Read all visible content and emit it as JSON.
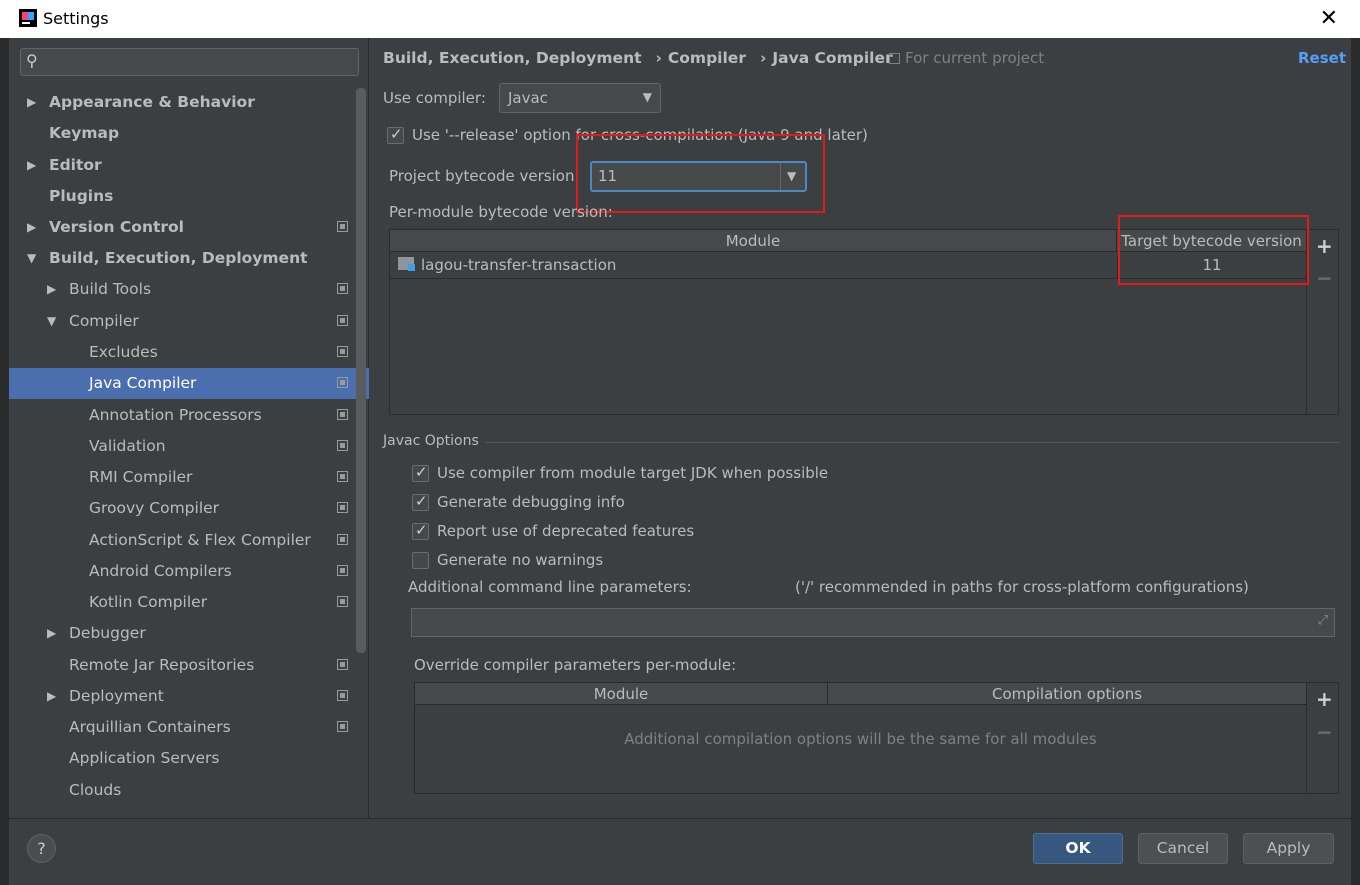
{
  "window": {
    "title": "Settings",
    "close_glyph": "✕"
  },
  "search": {
    "placeholder": "",
    "icon": "search-icon"
  },
  "sidebar": {
    "items": [
      {
        "label": "Appearance & Behavior",
        "arrow": "▶"
      },
      {
        "label": "Keymap"
      },
      {
        "label": "Editor",
        "arrow": "▶"
      },
      {
        "label": "Plugins"
      },
      {
        "label": "Version Control",
        "arrow": "▶"
      },
      {
        "label": "Build, Execution, Deployment",
        "arrow": "▼"
      },
      {
        "label": "Build Tools",
        "arrow": "▶"
      },
      {
        "label": "Compiler",
        "arrow": "▼"
      },
      {
        "label": "Excludes"
      },
      {
        "label": "Java Compiler"
      },
      {
        "label": "Annotation Processors"
      },
      {
        "label": "Validation"
      },
      {
        "label": "RMI Compiler"
      },
      {
        "label": "Groovy Compiler"
      },
      {
        "label": "ActionScript & Flex Compiler"
      },
      {
        "label": "Android Compilers"
      },
      {
        "label": "Kotlin Compiler"
      },
      {
        "label": "Debugger",
        "arrow": "▶"
      },
      {
        "label": "Remote Jar Repositories"
      },
      {
        "label": "Deployment",
        "arrow": "▶"
      },
      {
        "label": "Arquillian Containers"
      },
      {
        "label": "Application Servers"
      },
      {
        "label": "Clouds"
      }
    ]
  },
  "breadcrumb": {
    "part1": "Build, Execution, Deployment",
    "part2": "Compiler",
    "part3": "Java Compiler",
    "sep": "›"
  },
  "for_project": "For current project",
  "reset": "Reset",
  "use_compiler": {
    "label": "Use compiler:",
    "value": "Javac"
  },
  "release_option": {
    "label": "Use '--release' option for cross-compilation (Java 9 and later)",
    "checked": true
  },
  "project_bytecode": {
    "label": "Project bytecode version:",
    "value": "11"
  },
  "per_module": {
    "label": "Per-module bytecode version:",
    "columns": [
      "Module",
      "Target bytecode version"
    ],
    "rows": [
      {
        "module": "lagou-transfer-transaction",
        "version": "11"
      }
    ]
  },
  "javac_options": {
    "title": "Javac Options",
    "checkboxes": [
      {
        "label": "Use compiler from module target JDK when possible",
        "checked": true
      },
      {
        "label": "Generate debugging info",
        "checked": true
      },
      {
        "label": "Report use of deprecated features",
        "checked": true
      },
      {
        "label": "Generate no warnings",
        "checked": false
      }
    ],
    "params_label": "Additional command line parameters:",
    "params_hint": "('/' recommended in paths for cross-platform configurations)",
    "params_value": ""
  },
  "override": {
    "label": "Override compiler parameters per-module:",
    "columns": [
      "Module",
      "Compilation options"
    ],
    "empty_text": "Additional compilation options will be the same for all modules"
  },
  "toolbar": {
    "plus": "+",
    "minus": "−"
  },
  "buttons": {
    "help": "?",
    "ok": "OK",
    "cancel": "Cancel",
    "apply": "Apply"
  },
  "colors": {
    "selection": "#4b6eaf",
    "link": "#589df6",
    "highlight_box": "#e01b1b",
    "ok_button": "#365880"
  }
}
